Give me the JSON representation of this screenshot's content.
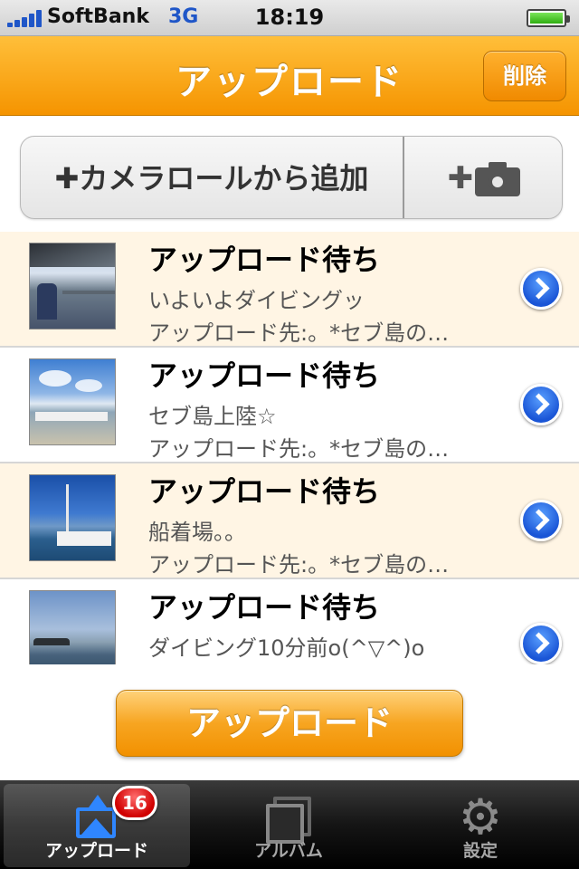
{
  "status_bar": {
    "carrier": "SoftBank",
    "network": "3G",
    "time": "18:19"
  },
  "nav": {
    "title": "アップロード",
    "delete_label": "削除"
  },
  "add_bar": {
    "camera_roll_label": "✚カメラロールから追加",
    "camera_plus": "✚"
  },
  "upload_list": [
    {
      "title": "アップロード待ち",
      "comment": "いよいよダイビングッ",
      "destination": "アップロード先:。*セブ島の…"
    },
    {
      "title": "アップロード待ち",
      "comment": "セブ島上陸☆",
      "destination": "アップロード先:。*セブ島の…"
    },
    {
      "title": "アップロード待ち",
      "comment": "船着場。。",
      "destination": "アップロード先:。*セブ島の…"
    },
    {
      "title": "アップロード待ち",
      "comment": "ダイビング10分前o(^▽^)o",
      "destination": ""
    }
  ],
  "upload_button_label": "アップロード",
  "tab_bar": {
    "tabs": [
      {
        "label": "アップロード",
        "icon": "upload-icon",
        "badge": "16"
      },
      {
        "label": "アルバム",
        "icon": "album-icon"
      },
      {
        "label": "設定",
        "icon": "gear-icon"
      }
    ]
  },
  "colors": {
    "accent": "#f59400",
    "list_alt_bg": "#fff5e4",
    "tab_active": "#2f86ff",
    "badge": "#d00000"
  }
}
